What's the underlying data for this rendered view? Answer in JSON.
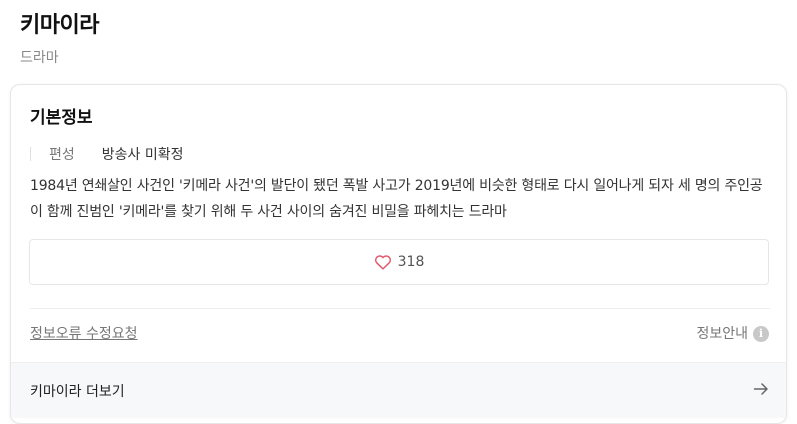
{
  "header": {
    "title": "키마이라",
    "subtitle": "드라마"
  },
  "card": {
    "section_title": "기본정보",
    "info": {
      "label": "편성",
      "value": "방송사 미확정"
    },
    "description": "1984년 연쇄살인 사건인 '키메라 사건'의 발단이 됐던 폭발 사고가 2019년에 비슷한 형태로 다시 일어나게 되자 세 명의 주인공이 함께 진범인 '키메라'를 찾기 위해 두 사건 사이의 숨겨진 비밀을 파헤치는 드라마",
    "like_count": "318",
    "report_link": "정보오류 수정요청",
    "info_guide": "정보안내",
    "info_icon": "i",
    "more_label": "키마이라 더보기"
  },
  "colors": {
    "heart": "#e05a6b",
    "muted": "#777777"
  },
  "icons": {
    "like": "heart-icon",
    "info": "info-icon",
    "arrow": "arrow-right-icon"
  }
}
